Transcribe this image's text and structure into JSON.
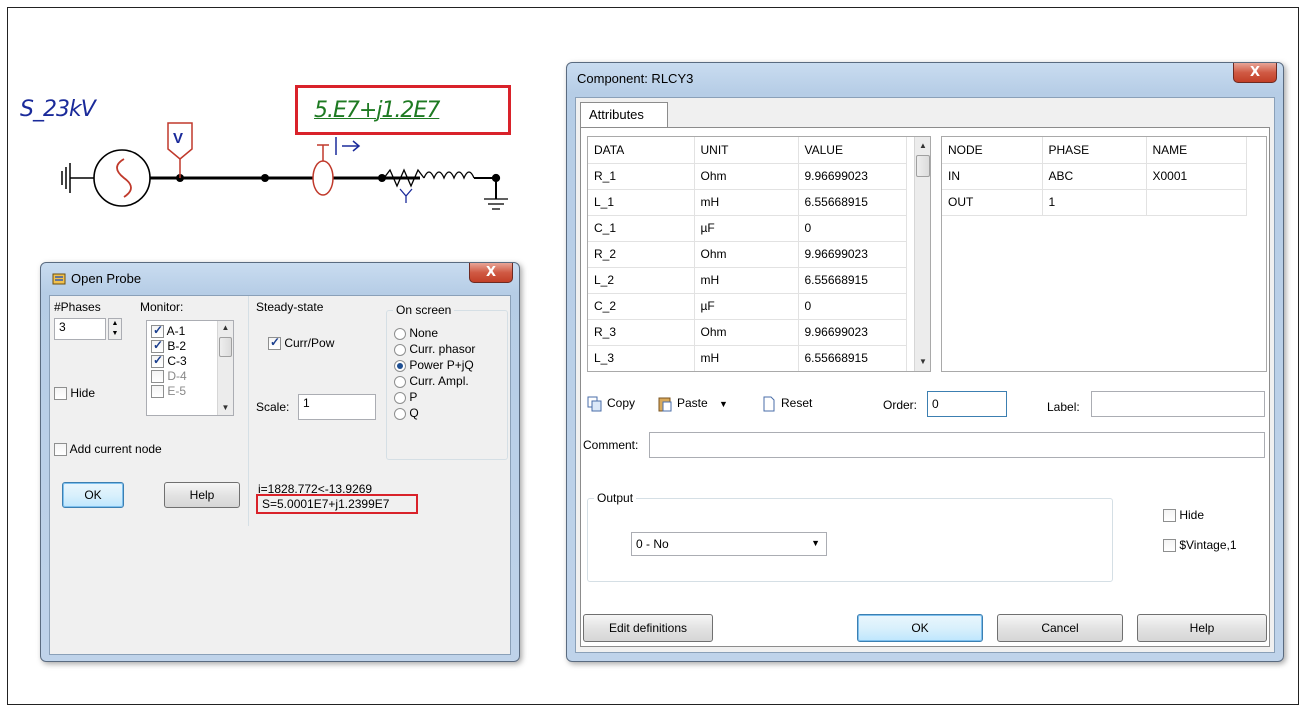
{
  "schematic": {
    "bus_label": "S_23kV",
    "voltage_probe_label": "V",
    "probe_value": "5.E7+j1.2E7",
    "load_label": "Y",
    "colors": {
      "label": "#1a2a9a",
      "value": "#1e7a22",
      "highlight": "#d9222a",
      "probe": "#c0392b"
    }
  },
  "probe_dialog": {
    "title": "Open Probe",
    "close_label": "X",
    "phases_label": "#Phases",
    "phases_value": "3",
    "monitor_label": "Monitor:",
    "monitor_items": [
      {
        "label": "A-1",
        "checked": true
      },
      {
        "label": "B-2",
        "checked": true
      },
      {
        "label": "C-3",
        "checked": true
      },
      {
        "label": "D-4",
        "checked": false
      },
      {
        "label": "E-5",
        "checked": false
      }
    ],
    "hide_label": "Hide",
    "add_node_label": "Add current node",
    "steady_state_label": "Steady-state",
    "curr_pow_label": "Curr/Pow",
    "scale_label": "Scale:",
    "scale_value": "1",
    "on_screen_label": "On screen",
    "on_screen_options": [
      {
        "label": "None",
        "selected": false
      },
      {
        "label": "Curr. phasor",
        "selected": false
      },
      {
        "label": "Power P+jQ",
        "selected": true
      },
      {
        "label": "Curr. Ampl.",
        "selected": false
      },
      {
        "label": "P",
        "selected": false
      },
      {
        "label": "Q",
        "selected": false
      }
    ],
    "current_result": "i=1828.772<-13.9269",
    "power_result": "S=5.0001E7+j1.2399E7",
    "ok_label": "OK",
    "help_label": "Help"
  },
  "component_dialog": {
    "title": "Component: RLCY3",
    "close_label": "X",
    "tab_label": "Attributes",
    "data_headers": [
      "DATA",
      "UNIT",
      "VALUE"
    ],
    "data_rows": [
      [
        "R_1",
        "Ohm",
        "9.96699023"
      ],
      [
        "L_1",
        "mH",
        "6.55668915"
      ],
      [
        "C_1",
        "µF",
        "0"
      ],
      [
        "R_2",
        "Ohm",
        "9.96699023"
      ],
      [
        "L_2",
        "mH",
        "6.55668915"
      ],
      [
        "C_2",
        "µF",
        "0"
      ],
      [
        "R_3",
        "Ohm",
        "9.96699023"
      ],
      [
        "L_3",
        "mH",
        "6.55668915"
      ]
    ],
    "node_headers": [
      "NODE",
      "PHASE",
      "NAME"
    ],
    "node_rows": [
      [
        "IN",
        "ABC",
        "X0001"
      ],
      [
        "OUT",
        "1",
        ""
      ]
    ],
    "copy_label": "Copy",
    "paste_label": "Paste",
    "reset_label": "Reset",
    "order_label": "Order:",
    "order_value": "0",
    "label_label": "Label:",
    "label_value": "",
    "comment_label": "Comment:",
    "comment_value": "",
    "output_label": "Output",
    "output_value": "0 - No",
    "hide_label": "Hide",
    "vintage_label": "$Vintage,1",
    "edit_definitions_label": "Edit definitions",
    "ok_label": "OK",
    "cancel_label": "Cancel",
    "help_label": "Help"
  }
}
